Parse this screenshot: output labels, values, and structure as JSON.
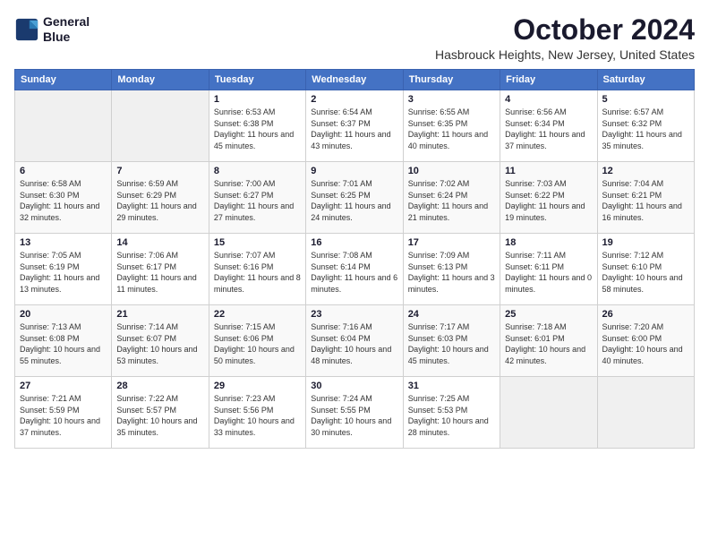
{
  "header": {
    "logo_line1": "General",
    "logo_line2": "Blue",
    "month_year": "October 2024",
    "location": "Hasbrouck Heights, New Jersey, United States"
  },
  "days_of_week": [
    "Sunday",
    "Monday",
    "Tuesday",
    "Wednesday",
    "Thursday",
    "Friday",
    "Saturday"
  ],
  "weeks": [
    [
      {
        "day": "",
        "info": ""
      },
      {
        "day": "",
        "info": ""
      },
      {
        "day": "1",
        "info": "Sunrise: 6:53 AM\nSunset: 6:38 PM\nDaylight: 11 hours and 45 minutes."
      },
      {
        "day": "2",
        "info": "Sunrise: 6:54 AM\nSunset: 6:37 PM\nDaylight: 11 hours and 43 minutes."
      },
      {
        "day": "3",
        "info": "Sunrise: 6:55 AM\nSunset: 6:35 PM\nDaylight: 11 hours and 40 minutes."
      },
      {
        "day": "4",
        "info": "Sunrise: 6:56 AM\nSunset: 6:34 PM\nDaylight: 11 hours and 37 minutes."
      },
      {
        "day": "5",
        "info": "Sunrise: 6:57 AM\nSunset: 6:32 PM\nDaylight: 11 hours and 35 minutes."
      }
    ],
    [
      {
        "day": "6",
        "info": "Sunrise: 6:58 AM\nSunset: 6:30 PM\nDaylight: 11 hours and 32 minutes."
      },
      {
        "day": "7",
        "info": "Sunrise: 6:59 AM\nSunset: 6:29 PM\nDaylight: 11 hours and 29 minutes."
      },
      {
        "day": "8",
        "info": "Sunrise: 7:00 AM\nSunset: 6:27 PM\nDaylight: 11 hours and 27 minutes."
      },
      {
        "day": "9",
        "info": "Sunrise: 7:01 AM\nSunset: 6:25 PM\nDaylight: 11 hours and 24 minutes."
      },
      {
        "day": "10",
        "info": "Sunrise: 7:02 AM\nSunset: 6:24 PM\nDaylight: 11 hours and 21 minutes."
      },
      {
        "day": "11",
        "info": "Sunrise: 7:03 AM\nSunset: 6:22 PM\nDaylight: 11 hours and 19 minutes."
      },
      {
        "day": "12",
        "info": "Sunrise: 7:04 AM\nSunset: 6:21 PM\nDaylight: 11 hours and 16 minutes."
      }
    ],
    [
      {
        "day": "13",
        "info": "Sunrise: 7:05 AM\nSunset: 6:19 PM\nDaylight: 11 hours and 13 minutes."
      },
      {
        "day": "14",
        "info": "Sunrise: 7:06 AM\nSunset: 6:17 PM\nDaylight: 11 hours and 11 minutes."
      },
      {
        "day": "15",
        "info": "Sunrise: 7:07 AM\nSunset: 6:16 PM\nDaylight: 11 hours and 8 minutes."
      },
      {
        "day": "16",
        "info": "Sunrise: 7:08 AM\nSunset: 6:14 PM\nDaylight: 11 hours and 6 minutes."
      },
      {
        "day": "17",
        "info": "Sunrise: 7:09 AM\nSunset: 6:13 PM\nDaylight: 11 hours and 3 minutes."
      },
      {
        "day": "18",
        "info": "Sunrise: 7:11 AM\nSunset: 6:11 PM\nDaylight: 11 hours and 0 minutes."
      },
      {
        "day": "19",
        "info": "Sunrise: 7:12 AM\nSunset: 6:10 PM\nDaylight: 10 hours and 58 minutes."
      }
    ],
    [
      {
        "day": "20",
        "info": "Sunrise: 7:13 AM\nSunset: 6:08 PM\nDaylight: 10 hours and 55 minutes."
      },
      {
        "day": "21",
        "info": "Sunrise: 7:14 AM\nSunset: 6:07 PM\nDaylight: 10 hours and 53 minutes."
      },
      {
        "day": "22",
        "info": "Sunrise: 7:15 AM\nSunset: 6:06 PM\nDaylight: 10 hours and 50 minutes."
      },
      {
        "day": "23",
        "info": "Sunrise: 7:16 AM\nSunset: 6:04 PM\nDaylight: 10 hours and 48 minutes."
      },
      {
        "day": "24",
        "info": "Sunrise: 7:17 AM\nSunset: 6:03 PM\nDaylight: 10 hours and 45 minutes."
      },
      {
        "day": "25",
        "info": "Sunrise: 7:18 AM\nSunset: 6:01 PM\nDaylight: 10 hours and 42 minutes."
      },
      {
        "day": "26",
        "info": "Sunrise: 7:20 AM\nSunset: 6:00 PM\nDaylight: 10 hours and 40 minutes."
      }
    ],
    [
      {
        "day": "27",
        "info": "Sunrise: 7:21 AM\nSunset: 5:59 PM\nDaylight: 10 hours and 37 minutes."
      },
      {
        "day": "28",
        "info": "Sunrise: 7:22 AM\nSunset: 5:57 PM\nDaylight: 10 hours and 35 minutes."
      },
      {
        "day": "29",
        "info": "Sunrise: 7:23 AM\nSunset: 5:56 PM\nDaylight: 10 hours and 33 minutes."
      },
      {
        "day": "30",
        "info": "Sunrise: 7:24 AM\nSunset: 5:55 PM\nDaylight: 10 hours and 30 minutes."
      },
      {
        "day": "31",
        "info": "Sunrise: 7:25 AM\nSunset: 5:53 PM\nDaylight: 10 hours and 28 minutes."
      },
      {
        "day": "",
        "info": ""
      },
      {
        "day": "",
        "info": ""
      }
    ]
  ]
}
